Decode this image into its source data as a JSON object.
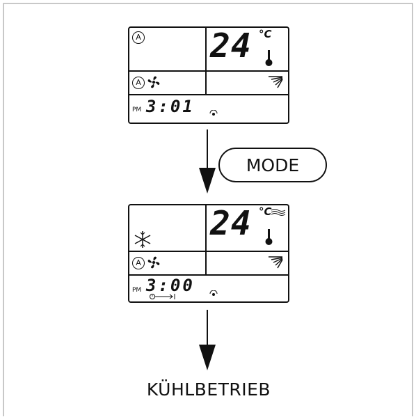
{
  "display_before": {
    "temperature": "24",
    "unit": "°C",
    "auto_label": "A",
    "fan_auto_label": "A",
    "time_period": "PM",
    "clock": "3:01"
  },
  "button": {
    "label": "MODE"
  },
  "display_after": {
    "temperature": "24",
    "unit": "°C",
    "fan_auto_label": "A",
    "time_period": "PM",
    "clock": "3:00"
  },
  "result": {
    "label": "KÜHLBETRIEB"
  },
  "icons": {
    "auto_mode": "circled-a-icon",
    "fan": "fan-icon",
    "thermometer": "thermometer-icon",
    "swing": "swing-louver-icon",
    "snowflake": "snowflake-cool-icon",
    "timer": "timer-icon",
    "signal": "signal-dot-icon",
    "wave": "airflow-wave-icon"
  }
}
